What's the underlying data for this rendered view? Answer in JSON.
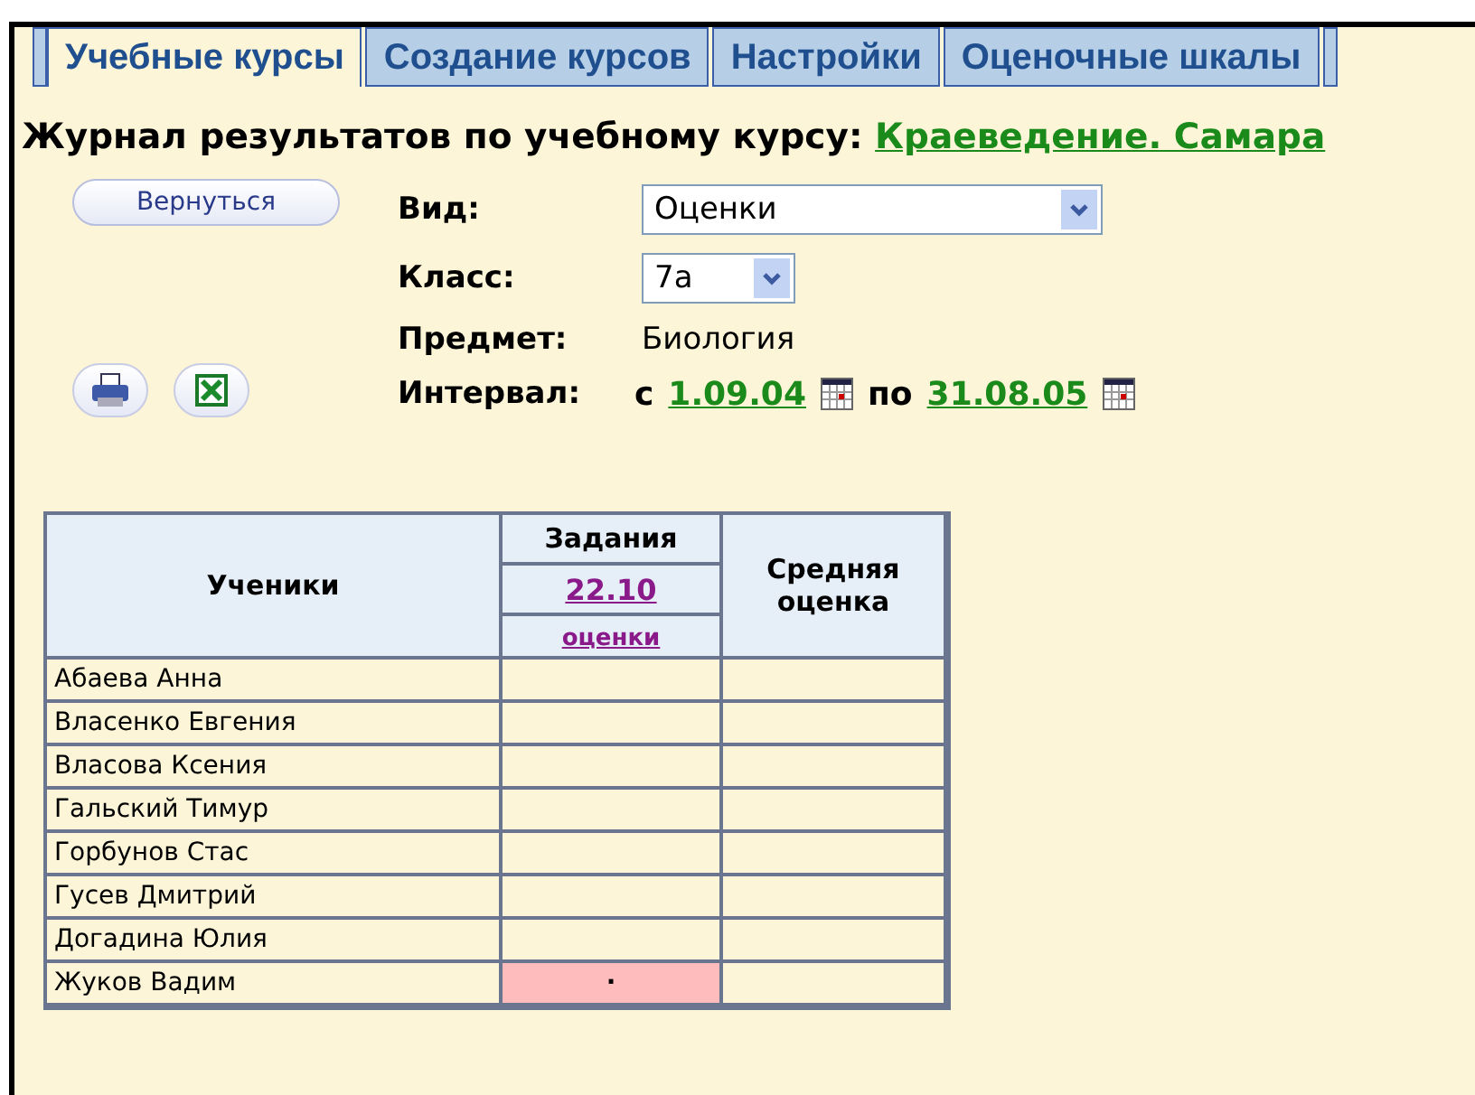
{
  "tabs": [
    {
      "label": "Учебные курсы",
      "selected": true
    },
    {
      "label": "Создание курсов",
      "selected": false
    },
    {
      "label": "Настройки",
      "selected": false
    },
    {
      "label": "Оценочные шкалы",
      "selected": false
    }
  ],
  "heading": {
    "label": "Журнал результатов по учебному курсу:",
    "course": "Краеведение. Самара"
  },
  "back_button": "Вернуться",
  "filters": {
    "view_label": "Вид:",
    "view_value": "Оценки",
    "class_label": "Класс:",
    "class_value": "7а",
    "subject_label": "Предмет:",
    "subject_value": "Биология",
    "interval_label": "Интервал:",
    "from_word": "с",
    "from_date": "1.09.04",
    "to_word": "по",
    "to_date": "31.08.05"
  },
  "table": {
    "students_header": "Ученики",
    "tasks_header": "Задания",
    "task_date": "22.10",
    "task_link": "оценки",
    "average_header": "Средняя оценка",
    "rows": [
      {
        "name": "Абаева Анна",
        "flagged": false
      },
      {
        "name": "Власенко Евгения",
        "flagged": false
      },
      {
        "name": "Власова Ксения",
        "flagged": false
      },
      {
        "name": "Гальский Тимур",
        "flagged": false
      },
      {
        "name": "Горбунов Стас",
        "flagged": false
      },
      {
        "name": "Гусев Дмитрий",
        "flagged": false
      },
      {
        "name": "Догадина Юлия",
        "flagged": false
      },
      {
        "name": "Жуков Вадим",
        "flagged": true,
        "mark": "·"
      }
    ]
  }
}
